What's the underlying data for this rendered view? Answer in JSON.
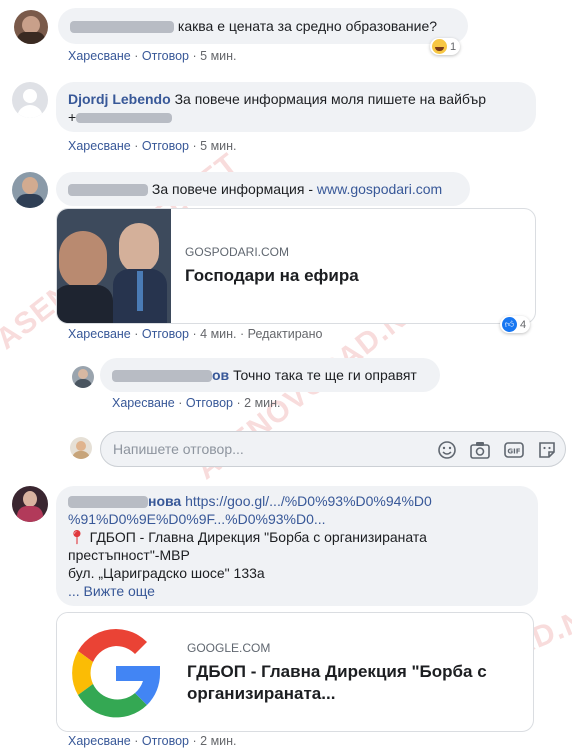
{
  "comments": {
    "c1": {
      "text": "каква е цената за средно образование?",
      "reaction_count": "1",
      "like": "Харесване",
      "reply": "Отговор",
      "time": "5 мин."
    },
    "c2": {
      "author": "Djordj Lebendo",
      "text": "За повече информация моля пишете на вайбър",
      "line2_prefix": "+",
      "like": "Харесване",
      "reply": "Отговор",
      "time": "5 мин."
    },
    "c3": {
      "text": "За повече информация - ",
      "link": "www.gospodari.com",
      "reaction_count": "4",
      "like": "Харесване",
      "reply": "Отговор",
      "time": "4 мин.",
      "edited": "Редактирано",
      "card": {
        "domain": "GOSPODARI.COM",
        "title": "Господари на ефира"
      }
    },
    "c4": {
      "author_suffix": "ов",
      "text": "Точно така те ще ги оправят",
      "like": "Харесване",
      "reply": "Отговор",
      "time": "2 мин."
    },
    "c5": {
      "author_suffix": "нова",
      "link1": "https://goo.gl/.../%D0%93%D0%94%D0",
      "link2": "%91%D0%9E%D0%9F...%D0%93%D0...",
      "line1": "ГДБОП - Главна Дирекция \"Борба с организираната",
      "line2": "престъпност\"-МВР",
      "line3": "бул. „Цариградско шосе\" 133а",
      "see_more": "... Вижте още",
      "card": {
        "domain": "GOOGLE.COM",
        "title1": "ГДБОП - Главна Дирекция \"Борба с",
        "title2": "организираната..."
      },
      "like": "Харесване",
      "reply": "Отговор",
      "time": "2 мин."
    }
  },
  "reply_box": {
    "placeholder": "Напишете отговор..."
  },
  "sep": "·",
  "watermark": "ASENOVGRAD.NET",
  "colors": {
    "link": "#385898",
    "bubble": "#f0f2f5",
    "like_blue": "#1877f2"
  }
}
